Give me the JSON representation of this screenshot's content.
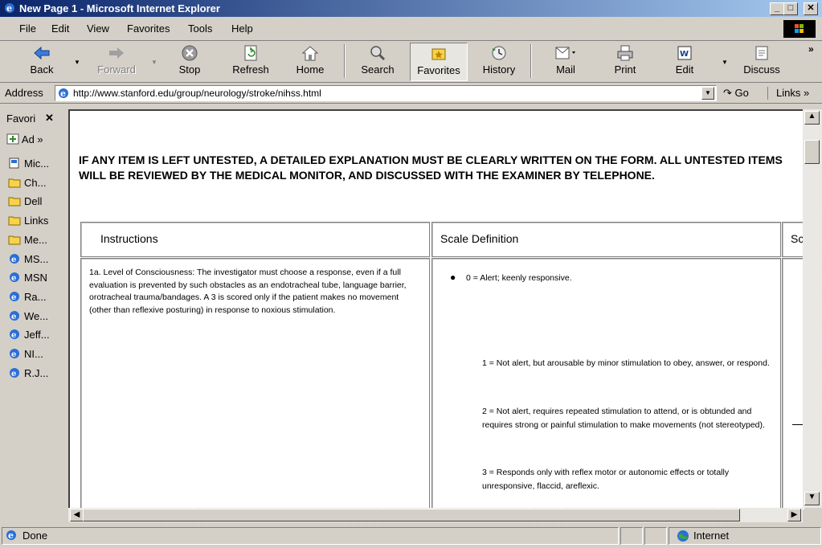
{
  "window": {
    "title": "New Page 1 - Microsoft Internet Explorer",
    "controls": {
      "minimize": "_",
      "maximize": "□",
      "close": "✕"
    }
  },
  "menu": [
    "File",
    "Edit",
    "View",
    "Favorites",
    "Tools",
    "Help"
  ],
  "toolbar": {
    "back": "Back",
    "forward": "Forward",
    "stop": "Stop",
    "refresh": "Refresh",
    "home": "Home",
    "search": "Search",
    "favorites": "Favorites",
    "history": "History",
    "mail": "Mail",
    "print": "Print",
    "edit": "Edit",
    "discuss": "Discuss",
    "more": "»"
  },
  "address": {
    "label": "Address",
    "url": "http://www.stanford.edu/group/neurology/stroke/nihss.html",
    "go": "Go",
    "links": "Links »"
  },
  "favorites_pane": {
    "title": "Favori",
    "close": "✕",
    "add": "Ad »",
    "items": [
      {
        "label": "Mic...",
        "icon": "msn-page-icon"
      },
      {
        "label": "Ch...",
        "icon": "folder-icon"
      },
      {
        "label": "Dell",
        "icon": "folder-icon"
      },
      {
        "label": "Links",
        "icon": "folder-icon"
      },
      {
        "label": "Me...",
        "icon": "folder-icon"
      },
      {
        "label": "MS...",
        "icon": "ie-page-icon"
      },
      {
        "label": "MSN",
        "icon": "ie-page-icon"
      },
      {
        "label": "Ra...",
        "icon": "ie-page-icon"
      },
      {
        "label": "We...",
        "icon": "ie-page-icon"
      },
      {
        "label": "Jeff...",
        "icon": "ie-page-icon"
      },
      {
        "label": "NI...",
        "icon": "ie-page-icon"
      },
      {
        "label": "R.J...",
        "icon": "ie-page-icon"
      }
    ]
  },
  "page": {
    "warning": "IF ANY ITEM IS LEFT UNTESTED, A DETAILED EXPLANATION MUST BE CLEARLY WRITTEN ON THE FORM. ALL UNTESTED ITEMS WILL BE REVIEWED BY THE MEDICAL MONITOR, AND DISCUSSED WITH THE EXAMINER BY TELEPHONE.",
    "table": {
      "headers": [
        "Instructions",
        "Scale Definition",
        "Sc"
      ],
      "row1": {
        "instructions": "1a. Level of Consciousness: The investigator must choose a response, even if a full evaluation is prevented by such obstacles as an endotracheal tube, language barrier, orotracheal trauma/bandages. A 3 is scored only if the patient makes no movement (other than reflexive posturing) in response to noxious stimulation.",
        "scale": [
          "0 = Alert; keenly responsive.",
          "1 = Not alert, but arousable by minor stimulation to obey, answer, or respond.",
          "2 = Not alert, requires repeated stimulation to attend, or is obtunded and requires strong or painful stimulation to make movements (not stereotyped).",
          "3 = Responds only with reflex motor or autonomic effects or totally unresponsive, flaccid, areflexic."
        ]
      }
    }
  },
  "status": {
    "text": "Done",
    "zone": "Internet"
  }
}
